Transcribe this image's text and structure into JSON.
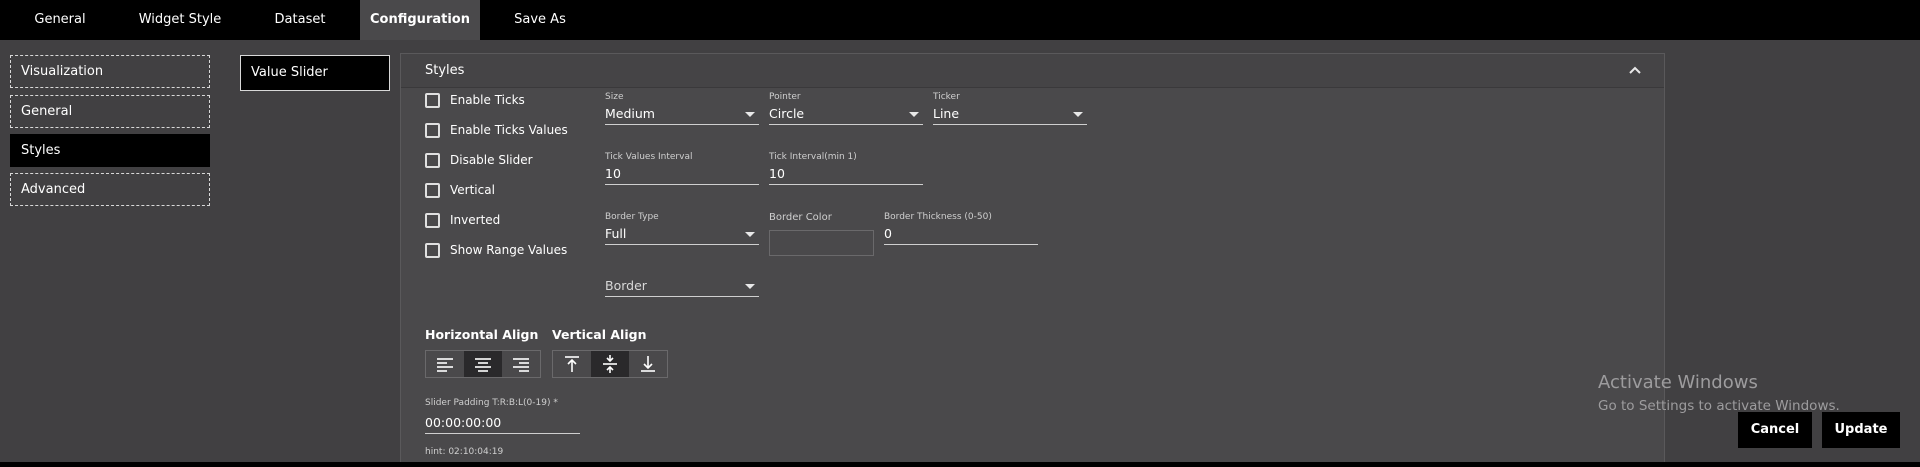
{
  "top_tabs": [
    {
      "label": "General"
    },
    {
      "label": "Widget Style"
    },
    {
      "label": "Dataset"
    },
    {
      "label": "Configuration",
      "active": true
    },
    {
      "label": "Save As"
    }
  ],
  "left_nav": [
    {
      "label": "Visualization"
    },
    {
      "label": "General"
    },
    {
      "label": "Styles",
      "active": true
    },
    {
      "label": "Advanced"
    }
  ],
  "widget_type": "Value Slider",
  "styles_panel": {
    "title": "Styles",
    "checkboxes": [
      {
        "label": "Enable Ticks",
        "checked": false
      },
      {
        "label": "Enable Ticks Values",
        "checked": false
      },
      {
        "label": "Disable Slider",
        "checked": false
      },
      {
        "label": "Vertical",
        "checked": false
      },
      {
        "label": "Inverted",
        "checked": false
      },
      {
        "label": "Show Range Values",
        "checked": false
      }
    ],
    "size": {
      "label": "Size",
      "value": "Medium"
    },
    "pointer": {
      "label": "Pointer",
      "value": "Circle"
    },
    "ticker": {
      "label": "Ticker",
      "value": "Line"
    },
    "tick_values_interval": {
      "label": "Tick Values Interval",
      "value": "10"
    },
    "tick_interval": {
      "label": "Tick Interval(min 1)",
      "value": "10"
    },
    "border_type": {
      "label": "Border Type",
      "value": "Full"
    },
    "border_color": {
      "label": "Border Color"
    },
    "border_thickness": {
      "label": "Border Thickness (0-50)",
      "value": "0"
    },
    "border_select": {
      "value": "Border"
    },
    "horizontal_align": {
      "label": "Horizontal Align",
      "selected": "center"
    },
    "vertical_align": {
      "label": "Vertical Align",
      "selected": "middle"
    },
    "slider_padding": {
      "label": "Slider Padding T:R:B:L(0-19) *",
      "value": "00:00:00:00",
      "hint": "hint: 02:10:04:19"
    }
  },
  "watermark": {
    "line1": "Activate Windows",
    "line2": "Go to Settings to activate Windows."
  },
  "actions": {
    "cancel": "Cancel",
    "update": "Update"
  },
  "colors": {
    "topbar": "#000000",
    "background": "#414042",
    "panel": "#4a494b",
    "active_nav": "#000000"
  }
}
